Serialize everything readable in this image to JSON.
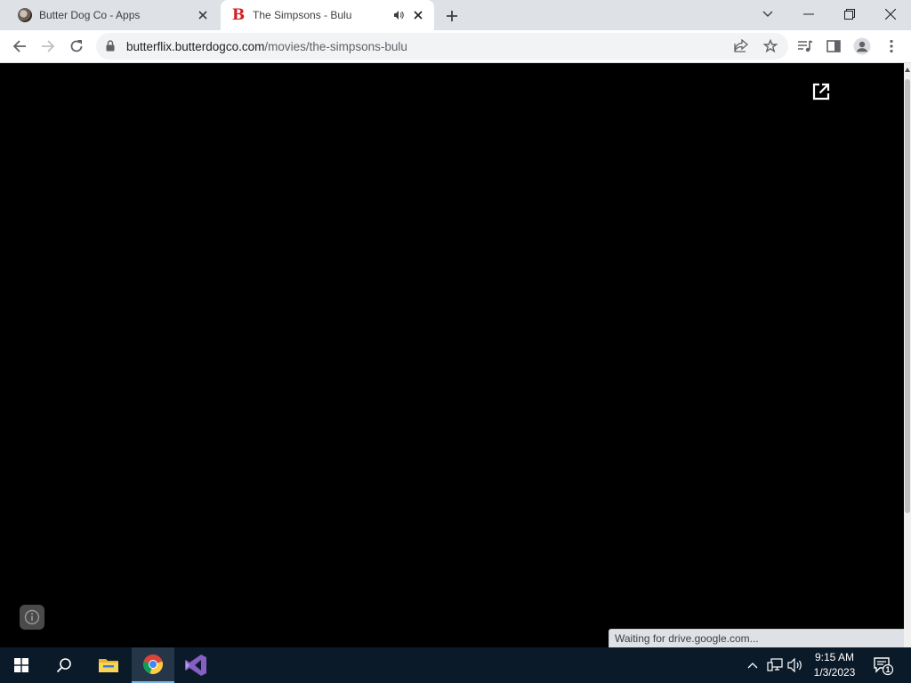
{
  "browser": {
    "tabs": [
      {
        "title": "Butter Dog Co - Apps",
        "favicon": "butter-dog-favicon",
        "active": false
      },
      {
        "title": "The Simpsons - Bulu",
        "favicon": "butterflix-b-favicon",
        "active": true,
        "audio": true
      }
    ],
    "address_bar": {
      "host": "butterflix.butterdogco.com",
      "path": "/movies/the-simpsons-bulu"
    },
    "status_bubble": "Waiting for drive.google.com..."
  },
  "taskbar": {
    "pinned": [
      "windows-start-icon",
      "search-icon",
      "file-explorer-icon",
      "chrome-icon",
      "visual-studio-icon"
    ],
    "clock": {
      "time": "9:15 AM",
      "date": "1/3/2023"
    },
    "notification_count": "1"
  },
  "colors": {
    "tabstrip": "#dee1e6",
    "brand_red": "#d21f26",
    "taskbar": "#0b1a29",
    "player_bg": "#000000"
  }
}
